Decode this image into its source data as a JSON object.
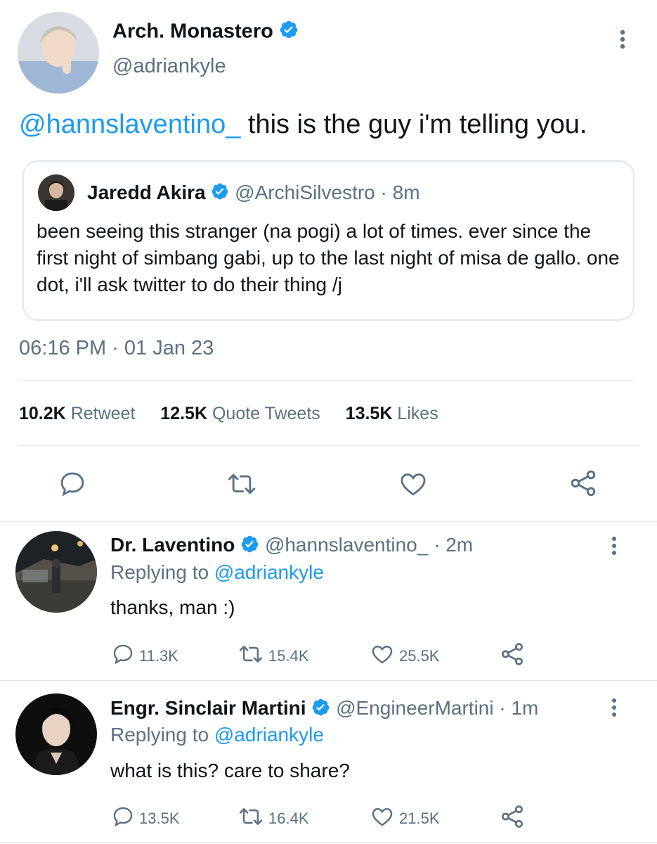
{
  "main_tweet": {
    "author_name": "Arch. Monastero",
    "author_handle": "@adriankyle",
    "mention": "@hannslaventino_",
    "text": " this is the guy i'm telling you.",
    "quoted": {
      "author_name": "Jaredd Akira",
      "meta": "@ArchiSilvestro · 8m",
      "text": "been seeing this stranger (na pogi) a lot of times. ever since the first night of simbang gabi, up to the last night of misa de gallo. one dot, i'll ask twitter to do their thing /j"
    },
    "timestamp": "06:16 PM · 01 Jan 23",
    "stats": [
      {
        "count": "10.2K",
        "label": "Retweet"
      },
      {
        "count": "12.5K",
        "label": "Quote Tweets"
      },
      {
        "count": "13.5K",
        "label": "Likes"
      }
    ]
  },
  "replies": [
    {
      "author_name": "Dr. Laventino",
      "meta": "@hannslaventino_ · 2m",
      "replying_prefix": "Replying to ",
      "replying_to": "@adriankyle",
      "text": "thanks, man :)",
      "reply_count": "11.3K",
      "retweet_count": "15.4K",
      "like_count": "25.5K"
    },
    {
      "author_name": "Engr. Sinclair Martini",
      "meta": "@EngineerMartini · 1m",
      "replying_prefix": "Replying to ",
      "replying_to": "@adriankyle",
      "text": "what is this? care to share?",
      "reply_count": "13.5K",
      "retweet_count": "16.4K",
      "like_count": "21.5K"
    }
  ],
  "colors": {
    "accent": "#1d9bf0",
    "muted": "#5b7083",
    "text": "#0f1419",
    "divider": "#e1e6ea"
  }
}
